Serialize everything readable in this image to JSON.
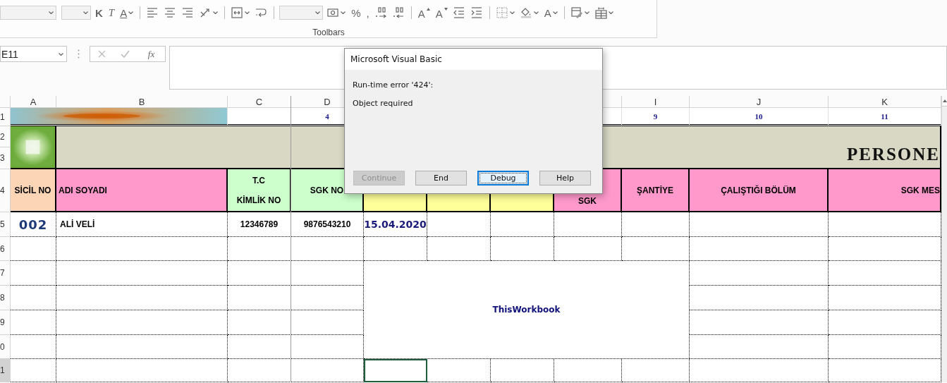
{
  "ribbon": {
    "items": [
      {
        "kind": "combo"
      },
      {
        "kind": "combo"
      },
      {
        "kind": "glyph",
        "text": "K"
      },
      {
        "kind": "glyph",
        "text": "T"
      },
      {
        "kind": "glyph",
        "text": "A"
      },
      {
        "kind": "separator"
      },
      {
        "kind": "icon"
      },
      {
        "kind": "icon"
      },
      {
        "kind": "icon"
      },
      {
        "kind": "icon"
      },
      {
        "kind": "separator"
      },
      {
        "kind": "icon"
      },
      {
        "kind": "icon"
      },
      {
        "kind": "separator"
      },
      {
        "kind": "combo"
      },
      {
        "kind": "icon"
      },
      {
        "kind": "glyph",
        "text": "%"
      },
      {
        "kind": "glyph",
        "text": ","
      },
      {
        "kind": "icon"
      },
      {
        "kind": "icon"
      },
      {
        "kind": "separator"
      },
      {
        "kind": "glyph",
        "text": "A"
      },
      {
        "kind": "glyph",
        "text": "A"
      },
      {
        "kind": "icon"
      },
      {
        "kind": "icon"
      },
      {
        "kind": "separator"
      },
      {
        "kind": "icon"
      },
      {
        "kind": "icon"
      },
      {
        "kind": "glyph",
        "text": "A"
      },
      {
        "kind": "separator"
      },
      {
        "kind": "icon"
      },
      {
        "kind": "icon"
      }
    ],
    "group_label": "Toolbars"
  },
  "formula_bar": {
    "name_box": "E11",
    "function_label": "fx"
  },
  "sheet": {
    "columns": [
      "A",
      "B",
      "C",
      "D",
      "",
      "",
      "",
      "",
      "I",
      "J",
      "K"
    ],
    "rows": [
      {
        "number": "1",
        "kind": "numbers",
        "cells": [
          {
            "kind": "picture",
            "colspan": 2
          },
          "",
          {
            "kind": "number",
            "text": "4"
          },
          "",
          "",
          "",
          "",
          {
            "kind": "number",
            "text": "9"
          },
          {
            "kind": "number",
            "text": "10"
          },
          {
            "kind": "number",
            "text": "11"
          }
        ]
      },
      {
        "number": "2",
        "kind": "banner",
        "cells": [
          {
            "kind": "picture",
            "rowspan": 2
          },
          {
            "kind": "title",
            "text": "PERSONE",
            "color": "#d8d8c4",
            "colspan": 10,
            "rowspan": 2
          }
        ]
      },
      {
        "number": "3"
      },
      {
        "number": "4",
        "kind": "header",
        "cells": [
          {
            "kind": "header",
            "lines": [
              "SİCİL NO"
            ],
            "color": "#fbd5b5"
          },
          {
            "kind": "header",
            "lines": [
              "ADI SOYADI"
            ],
            "color": "#ff99cc"
          },
          {
            "kind": "header",
            "lines": [
              "T.C",
              "KİMLİK NO"
            ],
            "color": "#ccffcc"
          },
          {
            "kind": "header",
            "lines": [
              "SGK NO"
            ],
            "color": "#ccffcc"
          },
          {
            "kind": "header",
            "color": "#ffff99"
          },
          {
            "kind": "header",
            "color": "#ffff99"
          },
          {
            "kind": "header",
            "color": "#ffff99"
          },
          {
            "kind": "header",
            "lines": [
              "SGK"
            ],
            "color": "#ff99cc"
          },
          {
            "kind": "header",
            "lines": [
              "ŞANTİYE"
            ],
            "color": "#ff99cc"
          },
          {
            "kind": "header",
            "lines": [
              "ÇALIŞTIĞI BÖLÜM"
            ],
            "color": "#ff99cc"
          },
          {
            "kind": "header",
            "lines": [
              "SGK MES"
            ],
            "color": "#ff99cc"
          }
        ]
      },
      {
        "number": "5",
        "kind": "body",
        "cells": [
          {
            "kind": "id",
            "text": "002"
          },
          {
            "kind": "name",
            "text": "ALİ VELİ"
          },
          {
            "kind": "value",
            "text": "12346789"
          },
          {
            "kind": "value",
            "text": "9876543210"
          },
          {
            "kind": "date",
            "text": "15.04.2020"
          },
          "",
          "",
          "",
          "",
          "",
          ""
        ]
      },
      {
        "number": "6",
        "kind": "body",
        "cells": [
          "",
          "",
          "",
          "",
          "",
          "",
          "",
          "",
          "",
          "",
          ""
        ]
      },
      {
        "number": "7",
        "kind": "body",
        "cells": [
          "",
          "",
          "",
          "",
          {
            "kind": "label",
            "text": "ThisWorkbook",
            "colspan": 5,
            "rowspan": 4
          },
          "",
          ""
        ]
      },
      {
        "number": "8",
        "kind": "body",
        "cells": [
          "",
          "",
          "",
          "",
          "",
          ""
        ]
      },
      {
        "number": "9",
        "kind": "body",
        "cells": [
          "",
          "",
          "",
          "",
          "",
          ""
        ]
      },
      {
        "number": "0",
        "kind": "body",
        "cells": [
          "",
          "",
          "",
          "",
          "",
          ""
        ]
      },
      {
        "number": "1",
        "kind": "body",
        "cells": [
          "",
          "",
          "",
          "",
          {
            "kind": "empty",
            "selected": true
          },
          "",
          "",
          "",
          "",
          "",
          ""
        ]
      }
    ]
  },
  "dialog": {
    "title": "Microsoft Visual Basic",
    "error": "Run-time error '424':",
    "message": "Object required",
    "buttons": [
      {
        "label": "Continue",
        "disabled": true,
        "focused": false
      },
      {
        "label": "End",
        "disabled": false,
        "focused": false
      },
      {
        "label": "Debug",
        "disabled": false,
        "focused": true
      },
      {
        "label": "Help",
        "disabled": false,
        "focused": false
      }
    ]
  }
}
